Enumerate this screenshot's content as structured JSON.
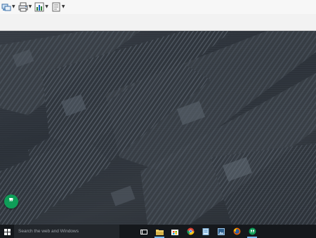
{
  "toolbar": {
    "tools": [
      {
        "name": "tool-network-icon"
      },
      {
        "name": "tool-print-icon"
      },
      {
        "name": "tool-chart-icon"
      },
      {
        "name": "tool-document-icon"
      }
    ]
  },
  "desktop": {
    "floating_button": {
      "icon": "hangouts-icon",
      "glyph": "❞"
    }
  },
  "taskbar": {
    "search_placeholder": "Search the web and Windows",
    "pinned": [
      {
        "icon": "task-view-icon",
        "active": false
      },
      {
        "icon": "file-explorer-icon",
        "active": true
      },
      {
        "icon": "store-icon",
        "active": false
      },
      {
        "icon": "chrome-icon",
        "active": false
      },
      {
        "icon": "notes-icon",
        "active": false
      },
      {
        "icon": "photos-icon",
        "active": false
      },
      {
        "icon": "firefox-icon",
        "active": false
      },
      {
        "icon": "hangouts-icon",
        "active": true
      }
    ]
  },
  "colors": {
    "taskbar": "#15181c",
    "search_box": "#23272c",
    "active_indicator": "#76b9ed",
    "hangouts_green": "#0f9d58",
    "toolbar_bg": "#f7f7f7"
  }
}
